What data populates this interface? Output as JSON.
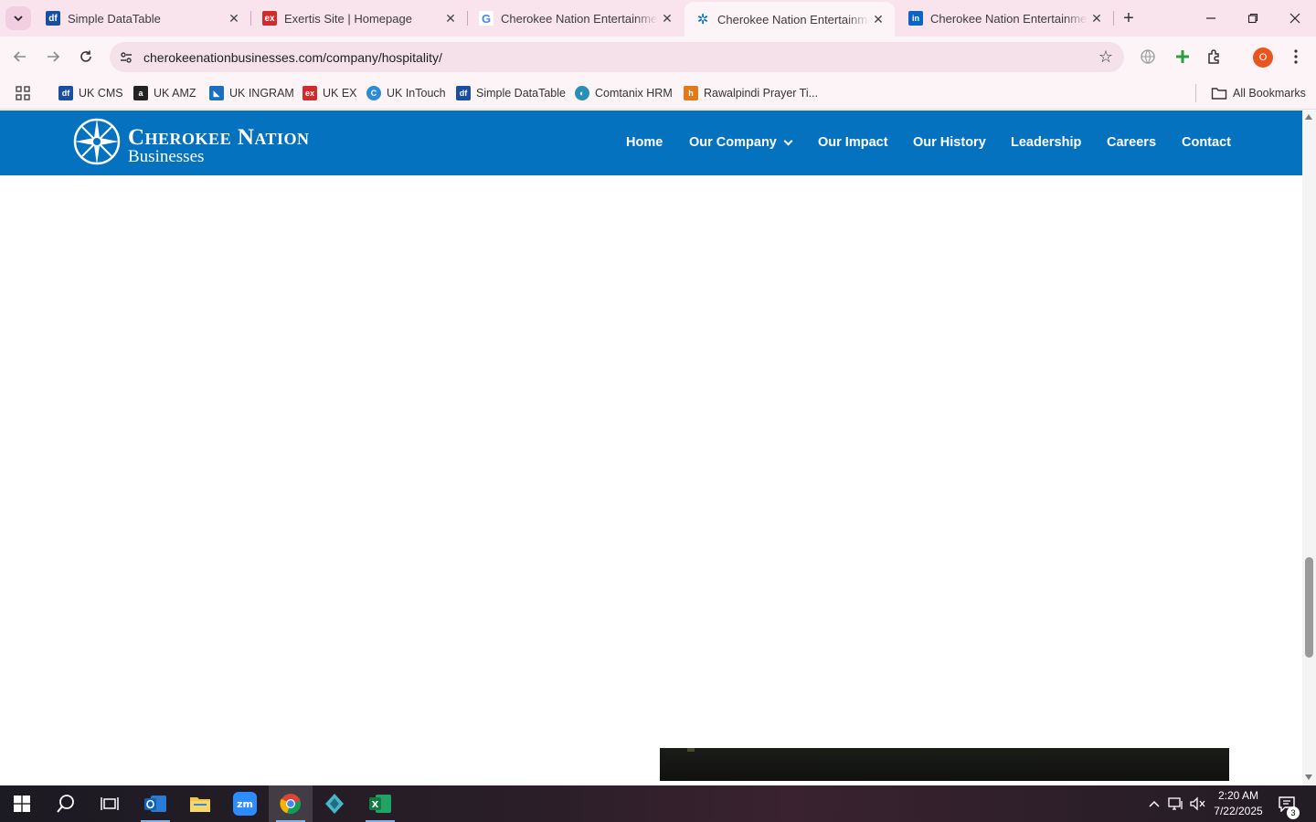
{
  "browser": {
    "tabs": [
      {
        "title": "Simple DataTable",
        "favicon": "df",
        "favicon_color": "#1a4fa0"
      },
      {
        "title": "Exertis Site | Homepage",
        "favicon": "ex",
        "favicon_color": "#d12b2b"
      },
      {
        "title": "Cherokee Nation Entertainment",
        "favicon": "G",
        "favicon_color": "#4285f4"
      },
      {
        "title": "Cherokee Nation Entertainment",
        "favicon": "✲",
        "favicon_color": "#0572c0"
      },
      {
        "title": "Cherokee Nation Entertainment",
        "favicon": "in",
        "favicon_color": "#0a66c2"
      }
    ],
    "address": "cherokeenationbusinesses.com/company/hospitality/",
    "profile_initial": "O",
    "bookmarks": [
      {
        "label": "UK CMS",
        "favicon": "df",
        "color": "#1a4fa0"
      },
      {
        "label": "UK AMZ",
        "favicon": "a",
        "color": "#222222"
      },
      {
        "label": "UK INGRAM",
        "favicon": "◣",
        "color": "#1b6fc2"
      },
      {
        "label": "UK EX",
        "favicon": "ex",
        "color": "#d12b2b"
      },
      {
        "label": "UK InTouch",
        "favicon": "C",
        "color": "#2d8ad6"
      },
      {
        "label": "Simple DataTable",
        "favicon": "df",
        "color": "#1a4fa0"
      },
      {
        "label": "Comtanix HRM",
        "favicon": "◐",
        "color": "#2a8fb5"
      },
      {
        "label": "Rawalpindi Prayer Ti...",
        "favicon": "h",
        "color": "#e07a1a"
      }
    ],
    "all_bookmarks": "All Bookmarks"
  },
  "site": {
    "logo_line1": "Cherokee Nation",
    "logo_line2": "Businesses",
    "nav": [
      "Home",
      "Our Company",
      "Our Impact",
      "Our History",
      "Leadership",
      "Careers",
      "Contact"
    ],
    "header_color": "#0572c0"
  },
  "taskbar": {
    "time": "2:20 AM",
    "date": "7/22/2025",
    "notifications": "3",
    "chrome_badge": "O"
  }
}
